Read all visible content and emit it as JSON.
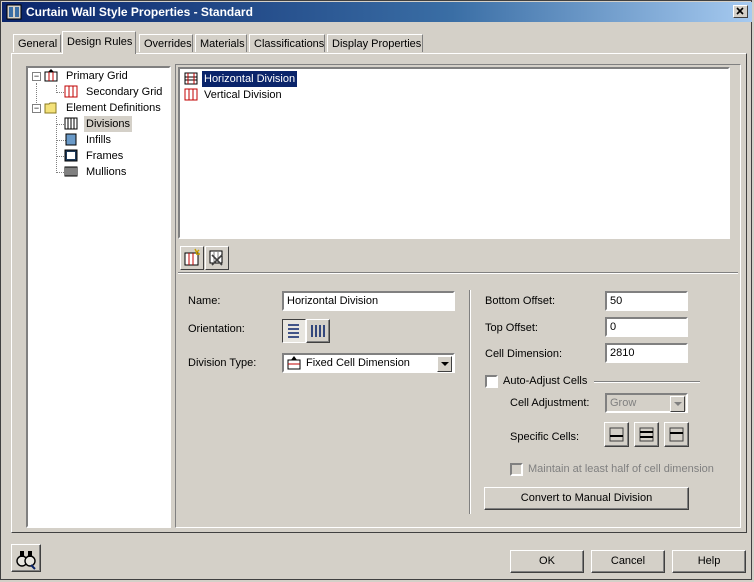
{
  "window": {
    "title": "Curtain Wall Style Properties - Standard"
  },
  "tabs": [
    {
      "label": "General"
    },
    {
      "label": "Design Rules",
      "active": true
    },
    {
      "label": "Overrides"
    },
    {
      "label": "Materials"
    },
    {
      "label": "Classifications"
    },
    {
      "label": "Display Properties"
    }
  ],
  "tree": {
    "primary_grid": "Primary Grid",
    "secondary_grid": "Secondary Grid",
    "element_definitions": "Element Definitions",
    "divisions": "Divisions",
    "infills": "Infills",
    "frames": "Frames",
    "mullions": "Mullions",
    "selected": "Divisions"
  },
  "division_list": [
    {
      "label": "Horizontal Division",
      "selected": true
    },
    {
      "label": "Vertical Division"
    }
  ],
  "form": {
    "name_label": "Name:",
    "name_value": "Horizontal Division",
    "orientation_label": "Orientation:",
    "division_type_label": "Division Type:",
    "division_type_value": "Fixed Cell Dimension",
    "bottom_offset_label": "Bottom Offset:",
    "bottom_offset_value": "50",
    "top_offset_label": "Top Offset:",
    "top_offset_value": "0",
    "cell_dimension_label": "Cell Dimension:",
    "cell_dimension_value": "2810",
    "auto_adjust_label": "Auto-Adjust Cells",
    "cell_adjustment_label": "Cell Adjustment:",
    "cell_adjustment_value": "Grow",
    "specific_cells_label": "Specific Cells:",
    "maintain_label": "Maintain at least half of cell dimension",
    "convert_button": "Convert to Manual Division"
  },
  "footer": {
    "ok": "OK",
    "cancel": "Cancel",
    "help": "Help"
  },
  "colors": {
    "title_active": "#0a246a",
    "face": "#d4d0c8",
    "selection": "#0a246a",
    "icon_red": "#c00000"
  }
}
